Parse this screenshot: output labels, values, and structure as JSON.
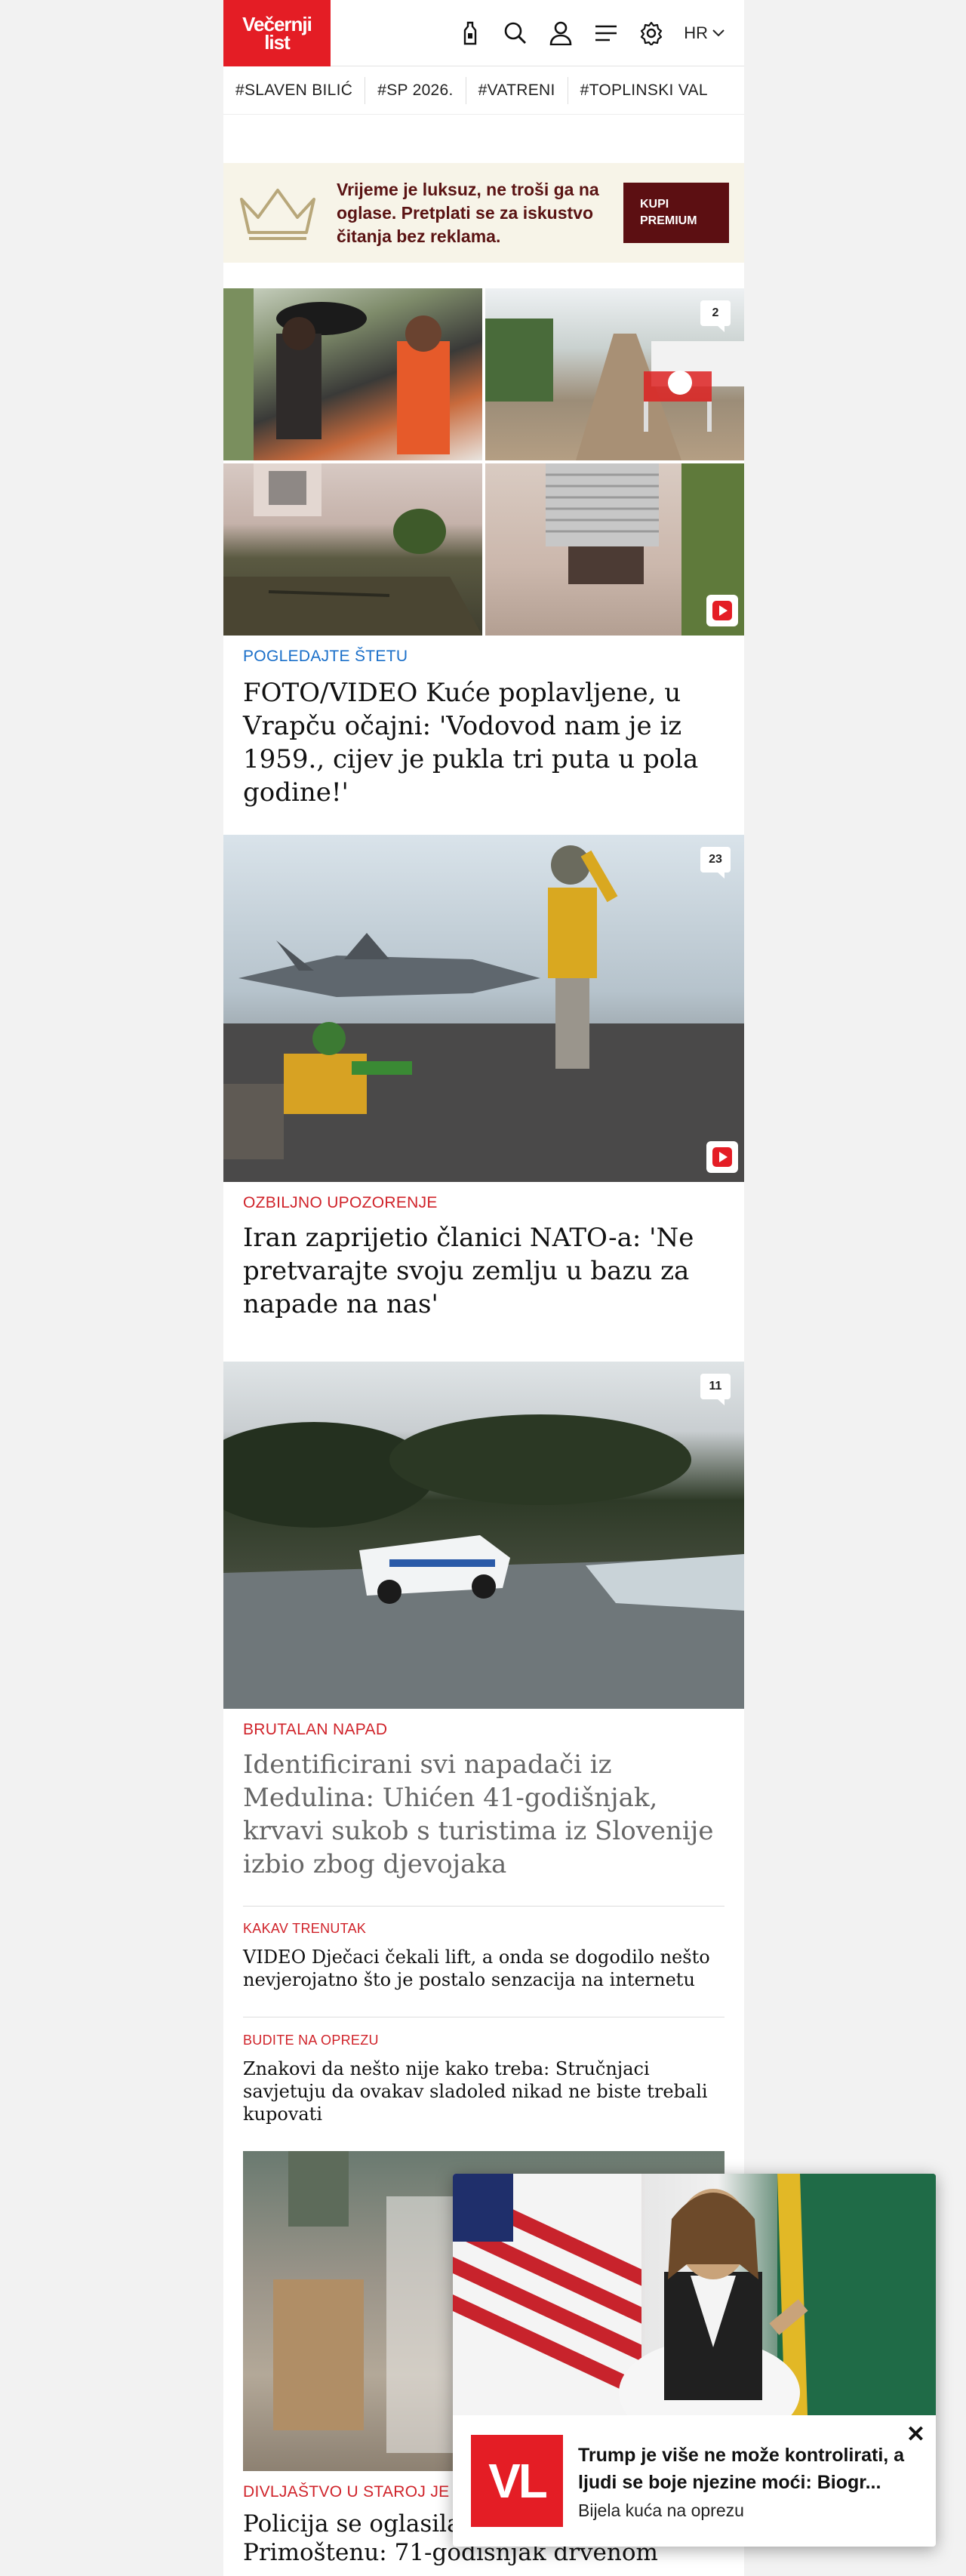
{
  "header": {
    "logo_line1": "Večernji",
    "logo_line2": "list",
    "lang": "HR"
  },
  "tags": [
    "#SLAVEN BILIĆ",
    "#SP 2026.",
    "#VATRENI",
    "#TOPLINSKI VAL"
  ],
  "promo": {
    "text": "Vrijeme je luksuz, ne troši ga na oglase. Pretplati se za iskustvo čitanja bez reklama.",
    "button_line1": "KUPI",
    "button_line2": "PREMIUM"
  },
  "articles": [
    {
      "kicker": "POGLEDAJTE ŠTETU",
      "kicker_color": "#1a6fc9",
      "headline": "FOTO/VIDEO Kuće poplavljene, u Vrapču očajni: 'Vodovod nam je iz 1959., cijev je pukla tri puta u pola godine!'",
      "comments": "2"
    },
    {
      "kicker": "OZBILJNO UPOZORENJE",
      "kicker_color": "#d0232a",
      "headline": "Iran zaprijetio članici NATO-a: 'Ne pretvarajte svoju zemlju u bazu za napade na nas'",
      "comments": "23"
    },
    {
      "kicker": "BRUTALAN NAPAD",
      "kicker_color": "#d0232a",
      "headline": "Identificirani svi napadači iz Medulina: Uhićen 41-godišnjak, krvavi sukob s turistima iz Slovenije izbio zbog djevojaka",
      "comments": "11"
    }
  ],
  "small_articles": [
    {
      "kicker": "KAKAV TRENUTAK",
      "headline": "VIDEO Dječaci čekali lift, a onda se dogodilo nešto nevjerojatno što je postalo senzacija na internetu"
    },
    {
      "kicker": "BUDITE NA OPREZU",
      "headline": "Znakovi da nešto nije kako treba: Stručnjaci savjetuju da ovakav sladoled nikad ne biste trebali kupovati"
    }
  ],
  "bottom_article": {
    "kicker": "DIVLJAŠTVO U STAROJ JE",
    "headline_l1": "Policija se oglasila o",
    "headline_l2": "Primoštenu: 71-godišnjak drvenom"
  },
  "float_ad": {
    "logo": "VL",
    "title": "Trump je više ne može kontrolirati, a ljudi se boje njezine moći: Biogr...",
    "subtitle": "Bijela kuća na oprezu",
    "close": "✕"
  },
  "colors": {
    "brand": "#e41d25",
    "promo_bg": "#f7f4e8",
    "promo_btn": "#5c0f12"
  },
  "icons": [
    "bottle-icon",
    "search-icon",
    "user-icon",
    "menu-icon",
    "gear-icon",
    "chevron-down-icon",
    "play-icon",
    "crown-icon"
  ]
}
